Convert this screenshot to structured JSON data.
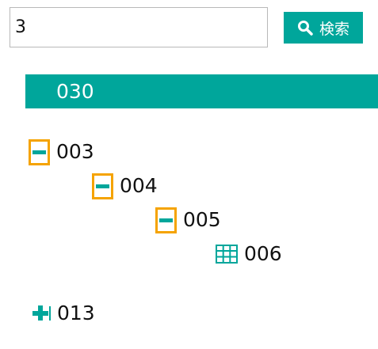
{
  "search": {
    "value": "3",
    "button_label": "検索"
  },
  "banner": {
    "label": "030"
  },
  "tree": {
    "nodes": [
      {
        "label": "003",
        "toggle": "collapse"
      },
      {
        "label": "004",
        "toggle": "collapse"
      },
      {
        "label": "005",
        "toggle": "collapse"
      },
      {
        "label": "006",
        "icon": "table-icon"
      },
      {
        "label": "013",
        "toggle": "expand"
      }
    ]
  },
  "colors": {
    "accent": "#00a69b",
    "toggle_border": "#f5a300"
  }
}
